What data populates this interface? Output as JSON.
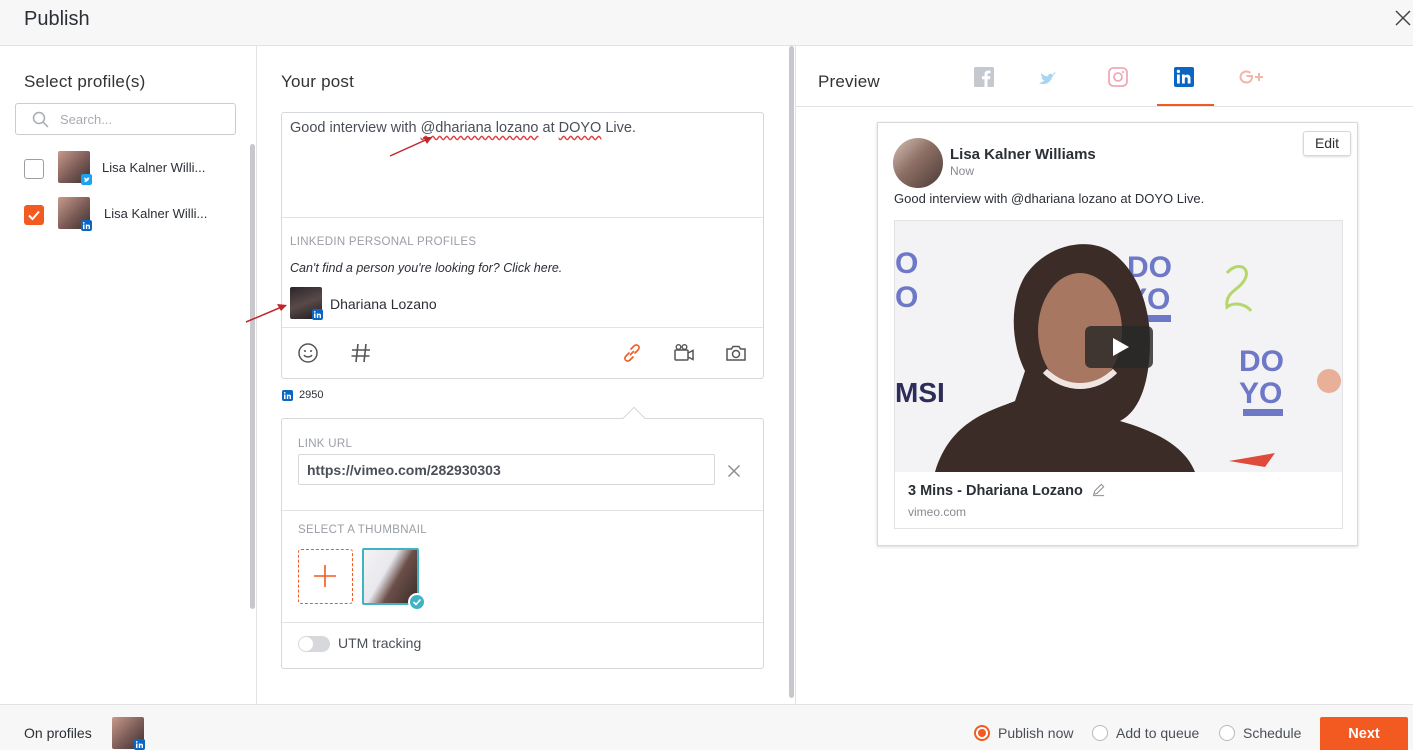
{
  "header": {
    "title": "Publish"
  },
  "profiles_panel": {
    "title": "Select profile(s)",
    "search_placeholder": "Search...",
    "profiles": [
      {
        "name": "Lisa Kalner Willi...",
        "network": "twitter",
        "checked": false
      },
      {
        "name": "Lisa Kalner Willi...",
        "network": "linkedin",
        "checked": true
      }
    ]
  },
  "post_panel": {
    "title": "Your post",
    "text_before": "Good interview with ",
    "mention": "@dhariana lozano",
    "text_middle": " at ",
    "org": "DOYO",
    "text_after": " Live.",
    "mentions_heading": "LINKEDIN PERSONAL PROFILES",
    "mentions_hint": "Can't find a person you're looking for? Click here.",
    "suggestion_name": "Dhariana Lozano",
    "char_count": "2950",
    "link_url_label": "LINK URL",
    "link_url_value": "https://vimeo.com/282930303",
    "thumbnail_label": "SELECT A THUMBNAIL",
    "utm_label": "UTM tracking"
  },
  "preview_panel": {
    "title": "Preview",
    "tabs": [
      "facebook",
      "twitter",
      "instagram",
      "linkedin",
      "google-plus"
    ],
    "active_tab": "linkedin",
    "card": {
      "author": "Lisa Kalner Williams",
      "time": "Now",
      "edit_label": "Edit",
      "text": "Good interview with @dhariana lozano at DOYO Live.",
      "video_title": "3 Mins - Dhariana Lozano",
      "video_domain": "vimeo.com"
    }
  },
  "footer": {
    "on_profiles_label": "On profiles",
    "options": [
      "Publish now",
      "Add to queue",
      "Schedule"
    ],
    "selected_option": "Publish now",
    "next_label": "Next"
  },
  "colors": {
    "accent": "#f25a22",
    "linkedin": "#0a66c2",
    "twitter": "#1da1f2",
    "teal": "#3fb3c4"
  }
}
